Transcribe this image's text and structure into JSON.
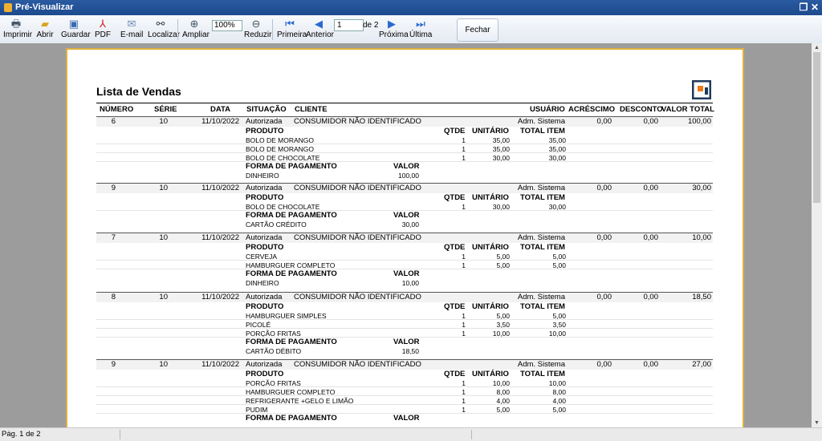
{
  "window": {
    "title": "Pré-Visualizar"
  },
  "toolbar": {
    "print": "Imprimir",
    "open": "Abrir",
    "save": "Guardar",
    "pdf": "PDF",
    "email": "E-mail",
    "find": "Localizar",
    "zoom_in": "Ampliar",
    "zoom_value": "100%",
    "zoom_out": "Reduzir",
    "first": "Primeira",
    "prev": "Anterior",
    "page_value": "1",
    "page_of": "de 2",
    "next": "Próxima",
    "last": "Última",
    "close": "Fechar"
  },
  "report": {
    "title": "Lista de Vendas",
    "columns": {
      "numero": "NÚMERO",
      "serie": "SÉRIE",
      "data": "DATA",
      "situacao": "SITUAÇÃO",
      "cliente": "CLIENTE",
      "usuario": "USUÁRIO",
      "acrescimo": "ACRÉSCIMO",
      "desconto": "DESCONTO",
      "valor_total": "VALOR TOTAL"
    },
    "sub": {
      "produto": "PRODUTO",
      "qtde": "QTDE",
      "unitario": "UNITÁRIO",
      "total_item": "TOTAL ITEM",
      "forma": "FORMA DE PAGAMENTO",
      "valor": "VALOR"
    },
    "sales": [
      {
        "numero": "6",
        "serie": "10",
        "data": "11/10/2022",
        "situacao": "Autorizada",
        "cliente": "CONSUMIDOR NÃO IDENTIFICADO",
        "usuario": "Adm. Sistema",
        "acrescimo": "0,00",
        "desconto": "0,00",
        "valor_total": "100,00",
        "items": [
          {
            "produto": "BOLO DE MORANGO",
            "qtde": "1",
            "unitario": "35,00",
            "total": "35,00"
          },
          {
            "produto": "BOLO DE MORANGO",
            "qtde": "1",
            "unitario": "35,00",
            "total": "35,00"
          },
          {
            "produto": "BOLO DE CHOCOLATE",
            "qtde": "1",
            "unitario": "30,00",
            "total": "30,00"
          }
        ],
        "payments": [
          {
            "forma": "DINHEIRO",
            "valor": "100,00"
          }
        ]
      },
      {
        "numero": "9",
        "serie": "10",
        "data": "11/10/2022",
        "situacao": "Autorizada",
        "cliente": "CONSUMIDOR NÃO IDENTIFICADO",
        "usuario": "Adm. Sistema",
        "acrescimo": "0,00",
        "desconto": "0,00",
        "valor_total": "30,00",
        "items": [
          {
            "produto": "BOLO DE CHOCOLATE",
            "qtde": "1",
            "unitario": "30,00",
            "total": "30,00"
          }
        ],
        "payments": [
          {
            "forma": "CARTÃO CRÉDITO",
            "valor": "30,00"
          }
        ]
      },
      {
        "numero": "7",
        "serie": "10",
        "data": "11/10/2022",
        "situacao": "Autorizada",
        "cliente": "CONSUMIDOR NÃO IDENTIFICADO",
        "usuario": "Adm. Sistema",
        "acrescimo": "0,00",
        "desconto": "0,00",
        "valor_total": "10,00",
        "items": [
          {
            "produto": "CERVEJA",
            "qtde": "1",
            "unitario": "5,00",
            "total": "5,00"
          },
          {
            "produto": "HAMBURGUER COMPLETO",
            "qtde": "1",
            "unitario": "5,00",
            "total": "5,00"
          }
        ],
        "payments": [
          {
            "forma": "DINHEIRO",
            "valor": "10,00"
          }
        ]
      },
      {
        "numero": "8",
        "serie": "10",
        "data": "11/10/2022",
        "situacao": "Autorizada",
        "cliente": "CONSUMIDOR NÃO IDENTIFICADO",
        "usuario": "Adm. Sistema",
        "acrescimo": "0,00",
        "desconto": "0,00",
        "valor_total": "18,50",
        "items": [
          {
            "produto": "HAMBURGUER SIMPLES",
            "qtde": "1",
            "unitario": "5,00",
            "total": "5,00"
          },
          {
            "produto": "PICOLÉ",
            "qtde": "1",
            "unitario": "3,50",
            "total": "3,50"
          },
          {
            "produto": "PORÇÃO FRITAS",
            "qtde": "1",
            "unitario": "10,00",
            "total": "10,00"
          }
        ],
        "payments": [
          {
            "forma": "CARTÃO DÉBITO",
            "valor": "18,50"
          }
        ]
      },
      {
        "numero": "9",
        "serie": "10",
        "data": "11/10/2022",
        "situacao": "Autorizada",
        "cliente": "CONSUMIDOR NÃO IDENTIFICADO",
        "usuario": "Adm. Sistema",
        "acrescimo": "0,00",
        "desconto": "0,00",
        "valor_total": "27,00",
        "items": [
          {
            "produto": "PORÇÃO FRITAS",
            "qtde": "1",
            "unitario": "10,00",
            "total": "10,00"
          },
          {
            "produto": "HAMBURGUER COMPLETO",
            "qtde": "1",
            "unitario": "8,00",
            "total": "8,00"
          },
          {
            "produto": "REFRIGERANTE +GELO E LIMÃO",
            "qtde": "1",
            "unitario": "4,00",
            "total": "4,00"
          },
          {
            "produto": "PUDIM",
            "qtde": "1",
            "unitario": "5,00",
            "total": "5,00"
          }
        ],
        "payments": []
      }
    ]
  },
  "status": {
    "page": "Pág. 1 de 2"
  }
}
